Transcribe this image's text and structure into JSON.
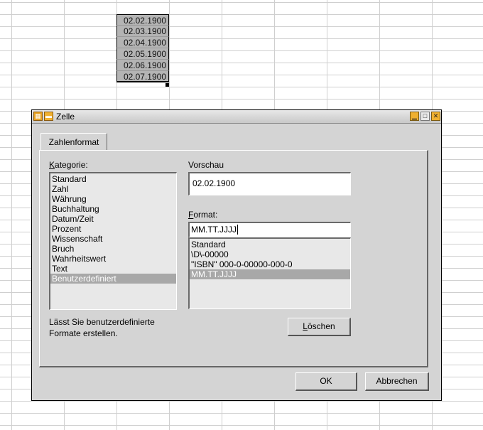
{
  "spreadsheet": {
    "cells": [
      "02.02.1900",
      "02.03.1900",
      "02.04.1900",
      "02.05.1900",
      "02.06.1900",
      "02.07.1900"
    ]
  },
  "dialog": {
    "title": "Zelle",
    "tab_label": "Zahlenformat",
    "category_label": "Kategorie:",
    "categories": [
      "Standard",
      "Zahl",
      "Währung",
      "Buchhaltung",
      "Datum/Zeit",
      "Prozent",
      "Wissenschaft",
      "Bruch",
      "Wahrheitswert",
      "Text",
      "Benutzerdefiniert"
    ],
    "selected_category": "Benutzerdefiniert",
    "description": "Lässt Sie benutzerdefinierte Formate erstellen.",
    "preview_label": "Vorschau",
    "preview_value": "02.02.1900",
    "format_label": "Format:",
    "format_value": "MM.TT.JJJJ",
    "formats": [
      "Standard",
      "\\D\\-00000",
      "\"ISBN\" 000-0-00000-000-0",
      "MM.TT.JJJJ"
    ],
    "selected_format": "MM.TT.JJJJ",
    "delete_button": "Löschen",
    "ok_button": "OK",
    "cancel_button": "Abbrechen"
  }
}
